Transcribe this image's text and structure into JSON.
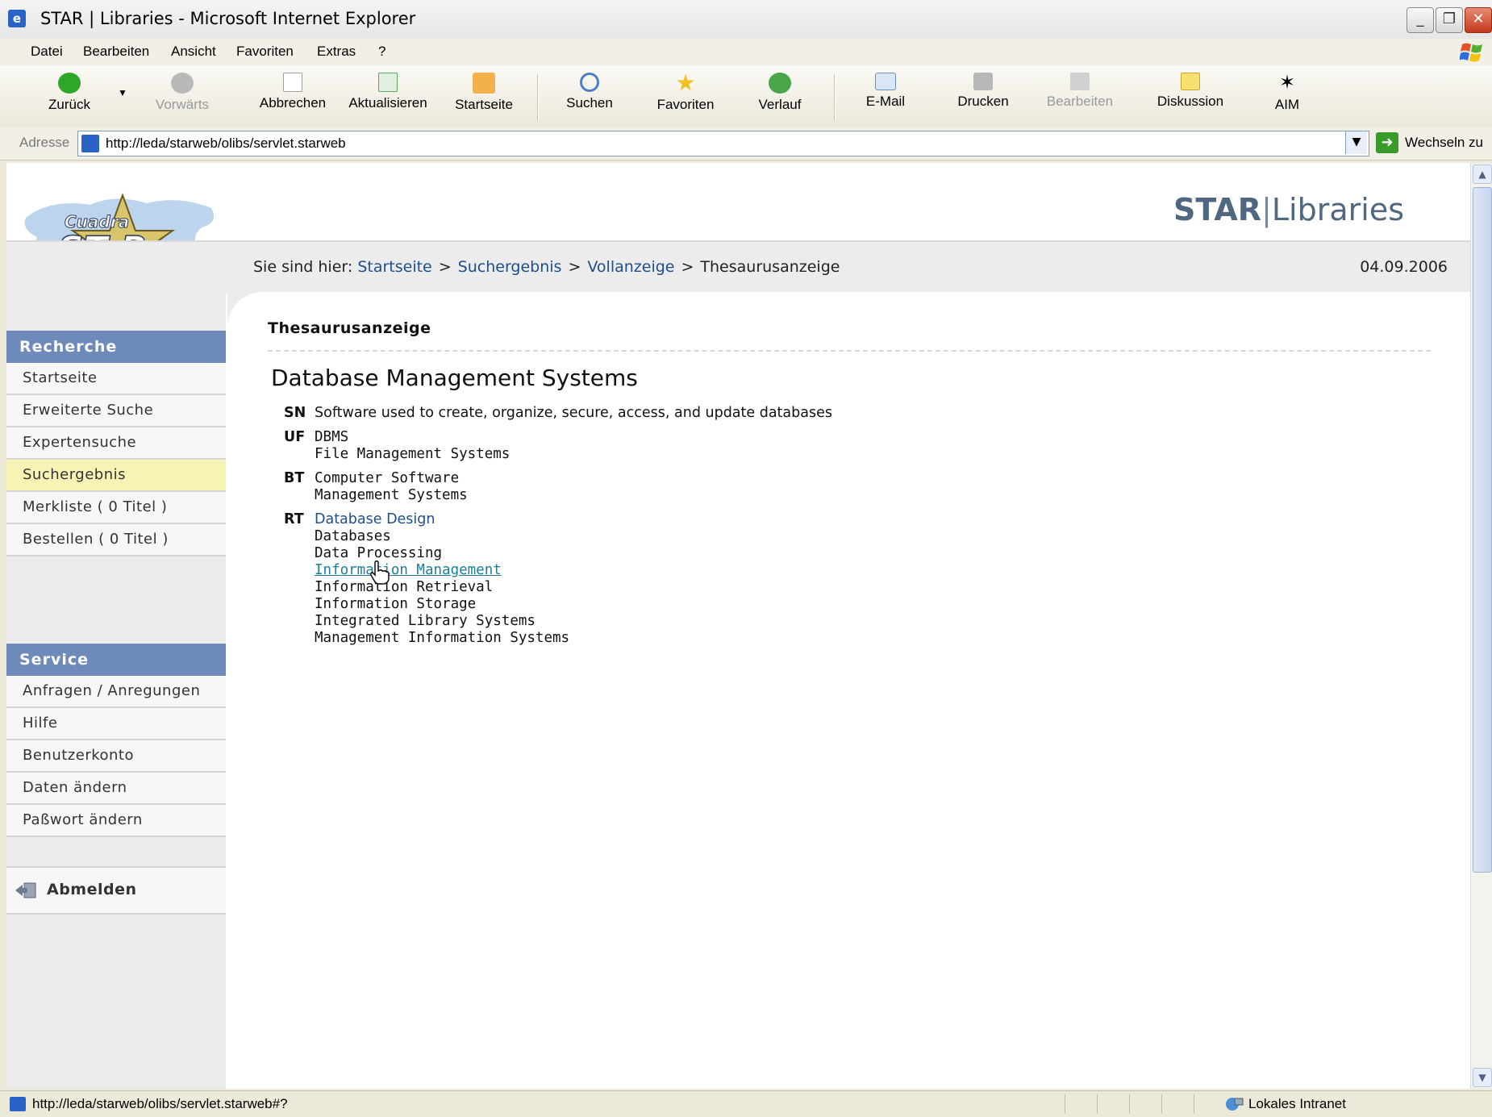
{
  "window": {
    "title": "STAR | Libraries - Microsoft Internet Explorer",
    "controls": {
      "minimize": "_",
      "maximize": "❐",
      "close": "✕"
    }
  },
  "menu": [
    "Datei",
    "Bearbeiten",
    "Ansicht",
    "Favoriten",
    "Extras",
    "?"
  ],
  "toolbar": {
    "back": {
      "label": "Zurück",
      "icon": "back-arrow-icon"
    },
    "forward": {
      "label": "Vorwärts",
      "icon": "forward-arrow-icon"
    },
    "stop": {
      "label": "Abbrechen",
      "icon": "stop-icon"
    },
    "refresh": {
      "label": "Aktualisieren",
      "icon": "refresh-icon"
    },
    "home": {
      "label": "Startseite",
      "icon": "home-icon"
    },
    "search": {
      "label": "Suchen",
      "icon": "search-icon"
    },
    "favorites": {
      "label": "Favoriten",
      "icon": "star-icon"
    },
    "history": {
      "label": "Verlauf",
      "icon": "history-icon"
    },
    "email": {
      "label": "E-Mail",
      "icon": "mail-icon"
    },
    "print": {
      "label": "Drucken",
      "icon": "printer-icon"
    },
    "edit": {
      "label": "Bearbeiten",
      "icon": "word-icon"
    },
    "discuss": {
      "label": "Diskussion",
      "icon": "note-icon"
    },
    "aim": {
      "label": "AIM",
      "icon": "aim-icon"
    }
  },
  "address": {
    "label": "Adresse",
    "url": "http://leda/starweb/olibs/servlet.starweb",
    "go_label": "Wechseln zu"
  },
  "site": {
    "logo_text": "Cuadra STAR",
    "brand_strong": "STAR",
    "brand_sep": "|",
    "brand_rest": "Libraries",
    "breadcrumb": {
      "prefix": "Sie sind hier:",
      "items": [
        "Startseite",
        "Suchergebnis",
        "Vollanzeige"
      ],
      "current": "Thesaurusanzeige",
      "sep": ">"
    },
    "date": "04.09.2006"
  },
  "sidebar": {
    "recherche_title": "Recherche",
    "recherche_items": [
      {
        "label": "Startseite"
      },
      {
        "label": "Erweiterte Suche"
      },
      {
        "label": "Expertensuche"
      },
      {
        "label": "Suchergebnis",
        "active": true
      },
      {
        "label": "Merkliste  ( 0 Titel )"
      },
      {
        "label": "Bestellen  ( 0 Titel )"
      }
    ],
    "service_title": "Service",
    "service_items": [
      {
        "label": "Anfragen / Anregungen"
      },
      {
        "label": "Hilfe"
      },
      {
        "label": "Benutzerkonto"
      },
      {
        "label": "Daten ändern"
      },
      {
        "label": "Paßwort ändern"
      }
    ],
    "logout": "Abmelden"
  },
  "main": {
    "section_title": "Thesaurusanzeige",
    "term": "Database Management Systems",
    "relations": [
      {
        "tag": "SN",
        "values": [
          "Software used to create, organize, secure, access, and update databases"
        ]
      },
      {
        "tag": "UF",
        "values": [
          "DBMS",
          "File Management Systems"
        ]
      },
      {
        "tag": "BT",
        "values": [
          "Computer Software",
          "Management Systems"
        ]
      },
      {
        "tag": "RT",
        "values": [
          "Database Design",
          "Databases",
          "Data Processing",
          "Information Management",
          "Information Retrieval",
          "Information Storage",
          "Integrated Library Systems",
          "Management Information Systems"
        ]
      }
    ]
  },
  "status": {
    "url": "http://leda/starweb/olibs/servlet.starweb#?",
    "zone": "Lokales Intranet"
  },
  "colors": {
    "sidebar_header": "#6e8aba",
    "active_item": "#f6f3b4",
    "link": "#1f4e8c",
    "hover_link": "#1a7f9a"
  }
}
